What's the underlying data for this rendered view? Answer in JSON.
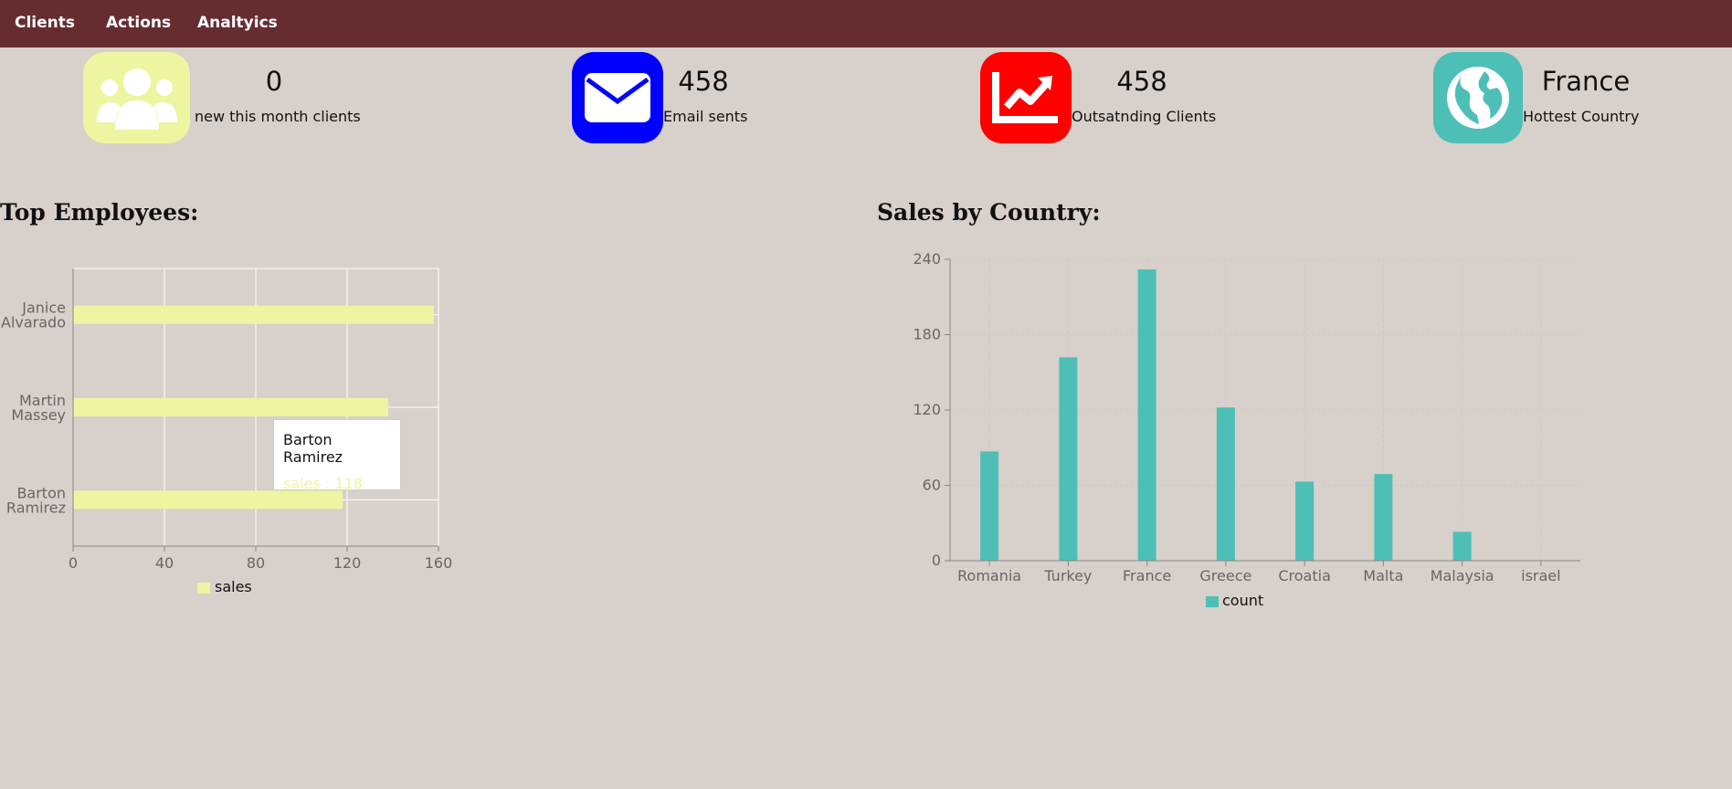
{
  "nav": {
    "items": [
      "Clients",
      "Actions",
      "Analtyics"
    ]
  },
  "stats": [
    {
      "value": "0",
      "label": "new this month clients",
      "icon": "users-icon",
      "color": "#eef5a0"
    },
    {
      "value": "458",
      "label": "Email sents",
      "icon": "envelope-icon",
      "color": "#0000ff"
    },
    {
      "value": "458",
      "label": "Outsatnding Clients",
      "icon": "chart-line-icon",
      "color": "#ff0000"
    },
    {
      "value": "France",
      "label": "Hottest Country",
      "icon": "globe-icon",
      "color": "#4dbfb7"
    }
  ],
  "employees_title": "Top Employees:",
  "sales_title": "Sales by Country:",
  "tooltip": {
    "name": "Barton Ramirez",
    "value_text": "sales : 118"
  },
  "chart_data": [
    {
      "type": "bar",
      "orientation": "horizontal",
      "categories": [
        "Janice Alvarado",
        "Martin Massey",
        "Barton Ramirez"
      ],
      "category_lines": [
        [
          "Janice",
          "Alvarado"
        ],
        [
          "Martin",
          "Massey"
        ],
        [
          "Barton",
          "Ramirez"
        ]
      ],
      "series": [
        {
          "name": "sales",
          "values": [
            158,
            138,
            118
          ],
          "color": "#eef5a0"
        }
      ],
      "xlim": [
        0,
        160
      ],
      "xticks": [
        "0",
        "40",
        "80",
        "120",
        "160"
      ],
      "grid": true,
      "legend": "bottom"
    },
    {
      "type": "bar",
      "categories": [
        "Romania",
        "Turkey",
        "France",
        "Greece",
        "Croatia",
        "Malta",
        "Malaysia",
        "israel"
      ],
      "series": [
        {
          "name": "count",
          "values": [
            87,
            162,
            232,
            122,
            63,
            69,
            23,
            0
          ],
          "color": "#4dbfb7"
        }
      ],
      "ylim": [
        0,
        240
      ],
      "yticks": [
        "0",
        "60",
        "120",
        "180",
        "240"
      ],
      "grid": true,
      "legend": "bottom"
    }
  ]
}
